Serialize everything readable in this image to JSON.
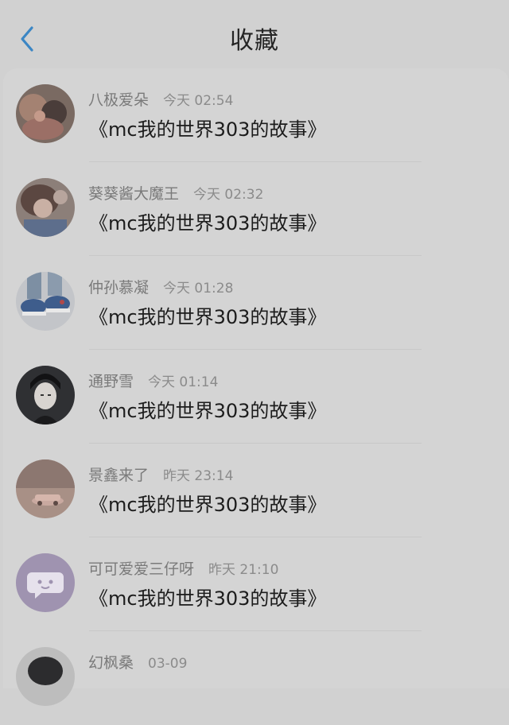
{
  "header": {
    "title": "收藏"
  },
  "items": [
    {
      "name": "八极爱朵",
      "time": "今天 02:54",
      "message": "《mc我的世界303的故事》"
    },
    {
      "name": "葵葵酱大魔王",
      "time": "今天 02:32",
      "message": "《mc我的世界303的故事》"
    },
    {
      "name": "仲孙慕凝",
      "time": "今天 01:28",
      "message": "《mc我的世界303的故事》"
    },
    {
      "name": "通野雪",
      "time": "今天 01:14",
      "message": "《mc我的世界303的故事》"
    },
    {
      "name": "景鑫来了",
      "time": "昨天 23:14",
      "message": "《mc我的世界303的故事》"
    },
    {
      "name": "可可爱爱三仔呀",
      "time": "昨天 21:10",
      "message": "《mc我的世界303的故事》"
    },
    {
      "name": "幻枫桑",
      "time": "03-09",
      "message": ""
    }
  ],
  "colors": {
    "accent": "#3b86c4",
    "background": "#d1d1d1"
  }
}
